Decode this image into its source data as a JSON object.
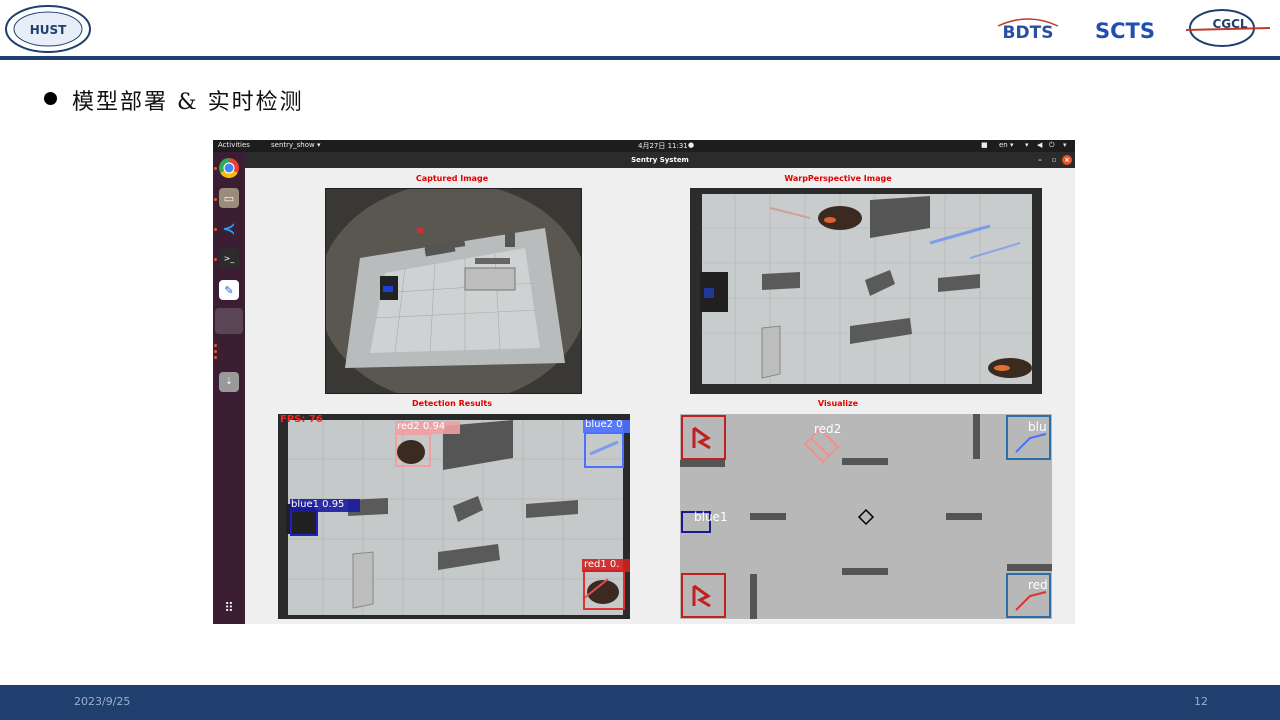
{
  "slide": {
    "title": "模型部署 & 实时检测",
    "footer_date": "2023/9/25",
    "page_number": "12"
  },
  "logos": {
    "bdts": "BDTS",
    "scts": "SCTS",
    "cgcl": "CGCL"
  },
  "desktop": {
    "activities": "Activities",
    "app_menu": "sentry_show ▾",
    "clock": "4月27日  11:31",
    "lang": "en ▾",
    "window_title": "Sentry System"
  },
  "panels": {
    "captured": "Captured Image",
    "warp": "WarpPerspective Image",
    "detection": "Detection Results",
    "visualize": "Visualize"
  },
  "detection": {
    "fps": "FPS: 76",
    "red2": "red2  0.94",
    "blue2": "blue2  0",
    "blue1": "blue1  0.95",
    "red1": "red1  0."
  },
  "visualize": {
    "red2": "red2",
    "blue1": "blue1",
    "blue_tr": "blu",
    "red_br": "red"
  },
  "colors": {
    "header_rule": "#1f3f6e",
    "panel_title": "#e00000",
    "red_box": "#e03030",
    "blue_box": "#2040d0"
  }
}
